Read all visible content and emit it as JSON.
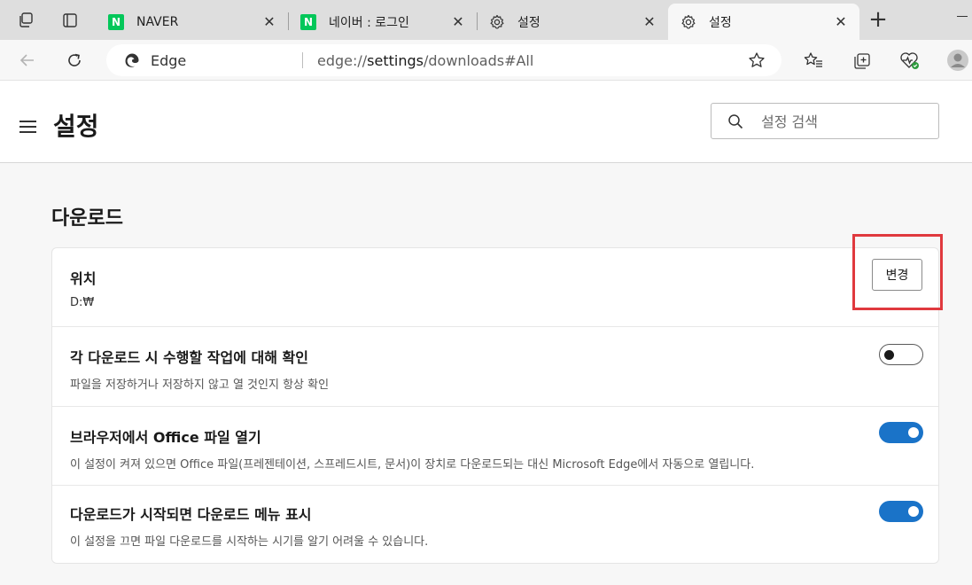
{
  "tabs": [
    {
      "label": "NAVER",
      "favicon": "naver-icon",
      "favicon_text": "N"
    },
    {
      "label": "네이버 : 로그인",
      "favicon": "naver-icon",
      "favicon_text": "N"
    },
    {
      "label": "설정",
      "favicon": "gear-icon"
    },
    {
      "label": "설정",
      "favicon": "gear-icon",
      "active": true
    }
  ],
  "address_bar": {
    "site_label": "Edge",
    "url_prefix": "edge://",
    "url_host": "settings",
    "url_path": "/downloads#All"
  },
  "header": {
    "title": "설정",
    "search_placeholder": "설정 검색"
  },
  "section": {
    "title": "다운로드"
  },
  "rows": {
    "location": {
      "title": "위치",
      "value": "D:₩",
      "button_label": "변경"
    },
    "ask_each": {
      "title": "각 다운로드 시 수행할 작업에 대해 확인",
      "description": "파일을 저장하거나 저장하지 않고 열 것인지 항상 확인",
      "toggle_on": false
    },
    "office": {
      "title": "브라우저에서 Office 파일 열기",
      "description": "이 설정이 켜져 있으면 Office 파일(프레젠테이션, 스프레드시트, 문서)이 장치로 다운로드되는 대신 Microsoft Edge에서 자동으로 열립니다.",
      "toggle_on": true
    },
    "menu": {
      "title": "다운로드가 시작되면 다운로드 메뉴 표시",
      "description": "이 설정을 끄면 파일 다운로드를 시작하는 시기를 알기 어려울 수 있습니다.",
      "toggle_on": true
    }
  },
  "colors": {
    "accent": "#1a73c8",
    "highlight": "#e0393e",
    "naver_green": "#03c75a"
  }
}
